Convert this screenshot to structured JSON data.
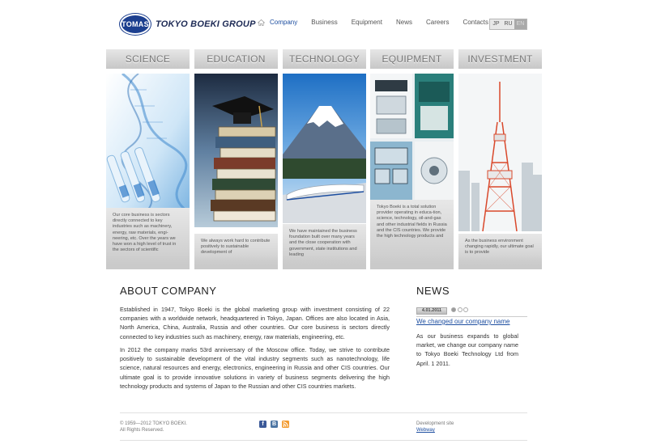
{
  "header": {
    "logo_badge": "TOMAS",
    "logo_text": "TOKYO BOEKI GROUP",
    "nav": [
      "Company",
      "Business",
      "Equipment",
      "News",
      "Careers",
      "Contacts"
    ],
    "active_nav": "Company",
    "languages": [
      "JP",
      "RU",
      "EN"
    ],
    "active_language": "EN"
  },
  "columns": [
    {
      "title": "SCIENCE",
      "image": "dna-test-tubes",
      "text": "Our core business is sectors directly connected to key industries such as machinery, energy, raw materials, engi-neering, etc. Over the years we have won a high level of trust in the sectors of scientific"
    },
    {
      "title": "EDUCATION",
      "image": "books-graduation-cap",
      "text": "We always work hard to contribute positively to sustainable development of"
    },
    {
      "title": "TECHNOLOGY",
      "image": "mount-fuji-train",
      "text": "We have maintained the business foundation built over many years and the close cooperation with government, state institutions and leading"
    },
    {
      "title": "EQUIPMENT",
      "image": "lab-equipment",
      "text": "Tokyo Boeki is a total solution provider operating in educa-tion, science, technology, oil-and-gas and other industrial fields in Russia and the CIS countries. We provide the high technology products and"
    },
    {
      "title": "INVESTMENT",
      "image": "tokyo-tower",
      "text": "As the business environment changing rapidly, our ultimate goal is to provide"
    }
  ],
  "about": {
    "title": "ABOUT COMPANY",
    "paragraphs": [
      "Established in 1947, Tokyo Boeki is the global marketing group with investment consisting of 22 companies with a worldwide network, headquartered in Tokyo, Japan. Offices are also located in Asia, North America, China, Australia, Russia and other countries. Our core business is sectors directly connected to key industries such as machinery, energy, raw materials, engineering, etc.",
      "In 2012 the company marks 53rd anniversary of the Moscow office. Today, we strive to contribute positively to sustainable development of the vital industry segments such as nanotechnology, life science, natural resources and energy, electronics, engineering in Russia and other CIS countries. Our ultimate goal is to provide innovative solutions in variety of business segments delivering the high technology products and systems of Japan to the Russian and other CIS countries markets."
    ]
  },
  "news": {
    "title": "NEWS",
    "date": "4.01.2011",
    "link": "We changed our company name",
    "text": "As our business expands to global market, we change our company name to Tokyo Boeki Technology Ltd from April. 1 2011.",
    "pager_active_index": 0
  },
  "footer": {
    "copyright_line1": "© 1959—2012 TOKYO BOEKI.",
    "copyright_line2": "All Rights Reserved.",
    "social": [
      "facebook-icon",
      "vk-icon",
      "rss-icon"
    ],
    "dev_label": "Development site",
    "dev_link": "Webway"
  },
  "colors": {
    "brand_blue": "#1c3f8f",
    "link_blue": "#1d4ea0",
    "facebook": "#3b5998",
    "vk": "#4c75a3",
    "rss": "#f39a2e"
  }
}
